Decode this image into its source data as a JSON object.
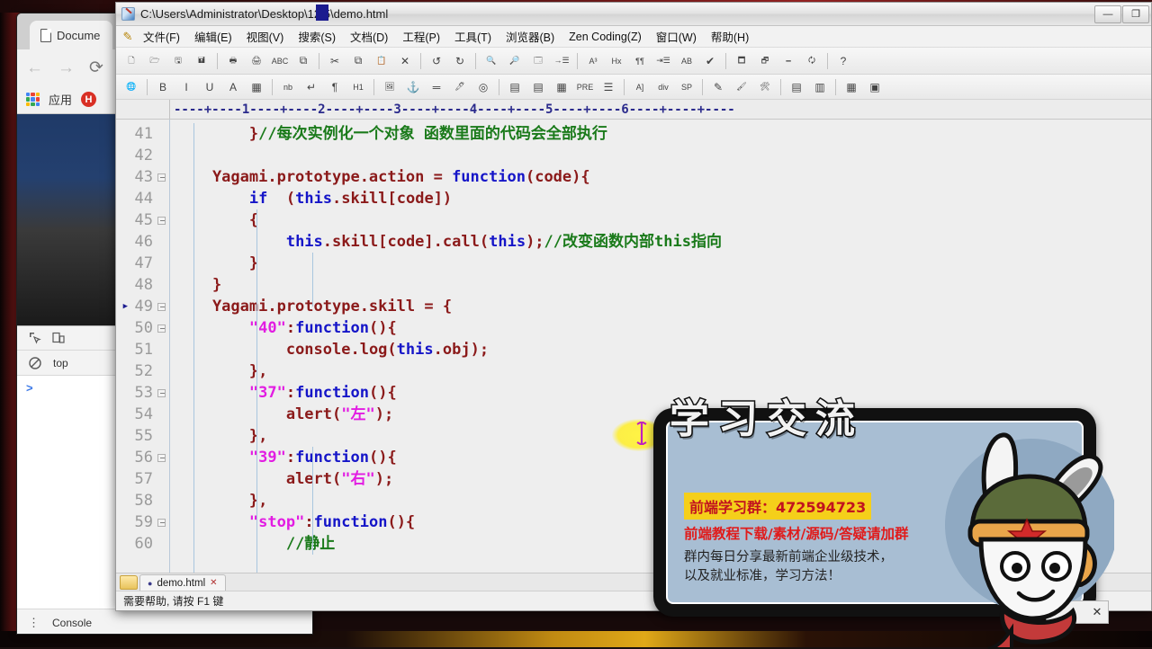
{
  "browser": {
    "tab": {
      "title": "Docume",
      "icon": "page-icon"
    },
    "nav": {
      "back": "←",
      "forward": "→",
      "reload": "⟳"
    },
    "bookmarks": {
      "apps_label": "应用",
      "h_logo": "H"
    },
    "devtools": {
      "inspect_icon": "inspect-element-icon",
      "device_icon": "device-toolbar-icon",
      "clear_icon": "clear-console-icon",
      "context_selector": "top",
      "prompt": ">",
      "footer_tab": "Console",
      "kebab": "⋮"
    }
  },
  "editor": {
    "title": "C:\\Users\\Administrator\\Desktop\\12.5\\demo.html",
    "window_buttons": {
      "minimize": "—",
      "maximize": "❐",
      "close": "✕"
    },
    "menu": [
      "文件(F)",
      "编辑(E)",
      "视图(V)",
      "搜索(S)",
      "文档(D)",
      "工程(P)",
      "工具(T)",
      "浏览器(B)",
      "Zen Coding(Z)",
      "窗口(W)",
      "帮助(H)"
    ],
    "toolbar1": [
      {
        "name": "new-file-icon",
        "glyph": "🗋"
      },
      {
        "name": "open-file-icon",
        "glyph": "🗁"
      },
      {
        "name": "save-icon",
        "glyph": "🖫"
      },
      {
        "name": "save-all-icon",
        "glyph": "🖬"
      },
      {
        "sep": true
      },
      {
        "name": "print-preview-icon",
        "glyph": "🖶"
      },
      {
        "name": "print-icon",
        "glyph": "🖨"
      },
      {
        "name": "spell-check-icon",
        "glyph": "ABC"
      },
      {
        "name": "preview-browser-icon",
        "glyph": "⧉"
      },
      {
        "sep": true
      },
      {
        "name": "cut-icon",
        "glyph": "✂"
      },
      {
        "name": "copy-icon",
        "glyph": "⧉"
      },
      {
        "name": "paste-icon",
        "glyph": "📋"
      },
      {
        "name": "delete-icon",
        "glyph": "✕"
      },
      {
        "sep": true
      },
      {
        "name": "undo-icon",
        "glyph": "↺"
      },
      {
        "name": "redo-icon",
        "glyph": "↻"
      },
      {
        "sep": true
      },
      {
        "name": "find-icon",
        "glyph": "🔍"
      },
      {
        "name": "replace-icon",
        "glyph": "🔎"
      },
      {
        "name": "find-in-files-icon",
        "glyph": "🗔"
      },
      {
        "name": "goto-line-icon",
        "glyph": "→☰"
      },
      {
        "sep": true
      },
      {
        "name": "font-icon",
        "glyph": "A³"
      },
      {
        "name": "hex-viewer-icon",
        "glyph": "Hx"
      },
      {
        "name": "wordwrap-icon",
        "glyph": "¶¶"
      },
      {
        "name": "indent-icon",
        "glyph": "⇥☰"
      },
      {
        "name": "sort-icon",
        "glyph": "AB"
      },
      {
        "name": "check-icon",
        "glyph": "✔"
      },
      {
        "sep": true
      },
      {
        "name": "toggle-directory-icon",
        "glyph": "🗖"
      },
      {
        "name": "toggle-output-icon",
        "glyph": "🗗"
      },
      {
        "name": "toggle-cliptext-icon",
        "glyph": "🗕"
      },
      {
        "name": "toggle-document-icon",
        "glyph": "🗘"
      },
      {
        "sep": true
      },
      {
        "name": "help-icon",
        "glyph": "?"
      }
    ],
    "toolbar2": [
      {
        "name": "html-globe-icon",
        "glyph": "🌐"
      },
      {
        "sep": true
      },
      {
        "name": "bold-icon",
        "glyph": "B"
      },
      {
        "name": "italic-icon",
        "glyph": "I"
      },
      {
        "name": "underline-icon",
        "glyph": "U"
      },
      {
        "name": "font-color-icon",
        "glyph": "A"
      },
      {
        "name": "color-palette-icon",
        "glyph": "▦"
      },
      {
        "sep": true
      },
      {
        "name": "nbsp-icon",
        "glyph": "nb"
      },
      {
        "name": "line-break-icon",
        "glyph": "↵"
      },
      {
        "name": "paragraph-icon",
        "glyph": "¶"
      },
      {
        "name": "heading-icon",
        "glyph": "H1"
      },
      {
        "sep": true
      },
      {
        "name": "insert-image-icon",
        "glyph": "🖼"
      },
      {
        "name": "anchor-icon",
        "glyph": "⚓"
      },
      {
        "name": "horizontal-rule-icon",
        "glyph": "═"
      },
      {
        "name": "highlight-icon",
        "glyph": "🖊"
      },
      {
        "name": "comment-icon",
        "glyph": "◎"
      },
      {
        "sep": true
      },
      {
        "name": "insert-table-icon",
        "glyph": "▤"
      },
      {
        "name": "table-row-icon",
        "glyph": "▤"
      },
      {
        "name": "table-cell-icon",
        "glyph": "▦"
      },
      {
        "name": "pre-tag-icon",
        "glyph": "PRE"
      },
      {
        "name": "list-icon",
        "glyph": "☰"
      },
      {
        "sep": true
      },
      {
        "name": "anchor-tag-icon",
        "glyph": "A]"
      },
      {
        "name": "div-tag-icon",
        "glyph": "div"
      },
      {
        "name": "span-tag-icon",
        "glyph": "SP"
      },
      {
        "sep": true
      },
      {
        "name": "edit-pencil-icon",
        "glyph": "✎"
      },
      {
        "name": "paint-icon",
        "glyph": "🖌"
      },
      {
        "name": "tools-icon",
        "glyph": "🛠"
      },
      {
        "sep": true
      },
      {
        "name": "form-icon",
        "glyph": "▤"
      },
      {
        "name": "frame-icon",
        "glyph": "▥"
      },
      {
        "sep": true
      },
      {
        "name": "css-icon",
        "glyph": "▦"
      },
      {
        "name": "script-icon",
        "glyph": "▣"
      }
    ],
    "ruler": {
      "text": "----+----1----+----2----+----3----+----4----+----5----+----6----+----+----",
      "caret_column_marker": "3"
    },
    "lines": [
      {
        "num": "41",
        "fold": false,
        "arrow": false
      },
      {
        "num": "42",
        "fold": false,
        "arrow": false
      },
      {
        "num": "43",
        "fold": true,
        "arrow": false
      },
      {
        "num": "44",
        "fold": false,
        "arrow": false
      },
      {
        "num": "45",
        "fold": true,
        "arrow": false
      },
      {
        "num": "46",
        "fold": false,
        "arrow": false
      },
      {
        "num": "47",
        "fold": false,
        "arrow": false
      },
      {
        "num": "48",
        "fold": false,
        "arrow": false
      },
      {
        "num": "49",
        "fold": true,
        "arrow": true
      },
      {
        "num": "50",
        "fold": true,
        "arrow": false
      },
      {
        "num": "51",
        "fold": false,
        "arrow": false
      },
      {
        "num": "52",
        "fold": false,
        "arrow": false
      },
      {
        "num": "53",
        "fold": true,
        "arrow": false
      },
      {
        "num": "54",
        "fold": false,
        "arrow": false
      },
      {
        "num": "55",
        "fold": false,
        "arrow": false
      },
      {
        "num": "56",
        "fold": true,
        "arrow": false
      },
      {
        "num": "57",
        "fold": false,
        "arrow": false
      },
      {
        "num": "58",
        "fold": false,
        "arrow": false
      },
      {
        "num": "59",
        "fold": true,
        "arrow": false
      },
      {
        "num": "60",
        "fold": false,
        "arrow": false
      }
    ],
    "code_lines": [
      [
        {
          "t": "pun",
          "s": "        }"
        },
        {
          "t": "com",
          "s": "//每次实例化一个对象 函数里面的代码会全部执行"
        }
      ],
      [
        {
          "t": "pun",
          "s": ""
        }
      ],
      [
        {
          "t": "id",
          "s": "    Yagami.prototype.action "
        },
        {
          "t": "pun",
          "s": "= "
        },
        {
          "t": "kw",
          "s": "function"
        },
        {
          "t": "pun",
          "s": "("
        },
        {
          "t": "id",
          "s": "code"
        },
        {
          "t": "pun",
          "s": "){"
        }
      ],
      [
        {
          "t": "pun",
          "s": "        "
        },
        {
          "t": "kw",
          "s": "if"
        },
        {
          "t": "pun",
          "s": "  ("
        },
        {
          "t": "kw",
          "s": "this"
        },
        {
          "t": "pun",
          "s": "."
        },
        {
          "t": "id",
          "s": "skill"
        },
        {
          "t": "pun",
          "s": "["
        },
        {
          "t": "id",
          "s": "code"
        },
        {
          "t": "pun",
          "s": "])"
        }
      ],
      [
        {
          "t": "pun",
          "s": "        {"
        }
      ],
      [
        {
          "t": "pun",
          "s": "            "
        },
        {
          "t": "kw",
          "s": "this"
        },
        {
          "t": "pun",
          "s": "."
        },
        {
          "t": "id",
          "s": "skill"
        },
        {
          "t": "pun",
          "s": "["
        },
        {
          "t": "id",
          "s": "code"
        },
        {
          "t": "pun",
          "s": "]."
        },
        {
          "t": "id",
          "s": "call"
        },
        {
          "t": "pun",
          "s": "("
        },
        {
          "t": "kw",
          "s": "this"
        },
        {
          "t": "pun",
          "s": ");"
        },
        {
          "t": "com",
          "s": "//改变函数内部this指向"
        }
      ],
      [
        {
          "t": "pun",
          "s": "        }"
        }
      ],
      [
        {
          "t": "pun",
          "s": "    }"
        }
      ],
      [
        {
          "t": "id",
          "s": "    Yagami.prototype.skill "
        },
        {
          "t": "pun",
          "s": "= {"
        }
      ],
      [
        {
          "t": "pun",
          "s": "        "
        },
        {
          "t": "str",
          "s": "\"40\""
        },
        {
          "t": "pun",
          "s": ":"
        },
        {
          "t": "kw",
          "s": "function"
        },
        {
          "t": "pun",
          "s": "(){"
        }
      ],
      [
        {
          "t": "pun",
          "s": "            "
        },
        {
          "t": "id",
          "s": "console.log"
        },
        {
          "t": "pun",
          "s": "("
        },
        {
          "t": "kw",
          "s": "this"
        },
        {
          "t": "pun",
          "s": "."
        },
        {
          "t": "id",
          "s": "obj"
        },
        {
          "t": "pun",
          "s": ");"
        }
      ],
      [
        {
          "t": "pun",
          "s": "        },"
        }
      ],
      [
        {
          "t": "pun",
          "s": "        "
        },
        {
          "t": "str",
          "s": "\"37\""
        },
        {
          "t": "pun",
          "s": ":"
        },
        {
          "t": "kw",
          "s": "function"
        },
        {
          "t": "pun",
          "s": "(){"
        }
      ],
      [
        {
          "t": "pun",
          "s": "            "
        },
        {
          "t": "id",
          "s": "alert"
        },
        {
          "t": "pun",
          "s": "("
        },
        {
          "t": "str",
          "s": "\"左\""
        },
        {
          "t": "pun",
          "s": ");"
        }
      ],
      [
        {
          "t": "pun",
          "s": "        },"
        }
      ],
      [
        {
          "t": "pun",
          "s": "        "
        },
        {
          "t": "str",
          "s": "\"39\""
        },
        {
          "t": "pun",
          "s": ":"
        },
        {
          "t": "kw",
          "s": "function"
        },
        {
          "t": "pun",
          "s": "(){"
        }
      ],
      [
        {
          "t": "pun",
          "s": "            "
        },
        {
          "t": "id",
          "s": "alert"
        },
        {
          "t": "pun",
          "s": "("
        },
        {
          "t": "str",
          "s": "\"右\""
        },
        {
          "t": "pun",
          "s": ");"
        }
      ],
      [
        {
          "t": "pun",
          "s": "        },"
        }
      ],
      [
        {
          "t": "pun",
          "s": "        "
        },
        {
          "t": "str",
          "s": "\"stop\""
        },
        {
          "t": "pun",
          "s": ":"
        },
        {
          "t": "kw",
          "s": "function"
        },
        {
          "t": "pun",
          "s": "(){"
        }
      ],
      [
        {
          "t": "pun",
          "s": "            "
        },
        {
          "t": "com",
          "s": "//静止"
        }
      ]
    ],
    "tab": {
      "label": "demo.html",
      "modified_dot": "●",
      "close": "✕"
    },
    "statusbar": "需要帮助, 请按 F1 键"
  },
  "ad": {
    "title": "学习交流",
    "group_line": "前端学习群：472594723",
    "promo_line": "前端教程下载/素材/源码/答疑请加群",
    "desc_line": "群内每日分享最新前端企业级技术，\n以及就业标准，学习方法！",
    "close": "✕",
    "colors": {
      "highlight": "#f5cf1a",
      "group_text": "#c1121f",
      "promo": "#e01b1b",
      "panel": "#a8bed3"
    }
  },
  "colors": {
    "code_identifier": "#8b1a1a",
    "code_keyword": "#1515c8",
    "code_string": "#e21ce2",
    "code_comment": "#1a7a1a",
    "editor_bg": "#eeeeee",
    "gutter_text": "#9a9a9a",
    "ruler_text": "#2a2a8c",
    "caret_marker": "#1b1b8f"
  }
}
